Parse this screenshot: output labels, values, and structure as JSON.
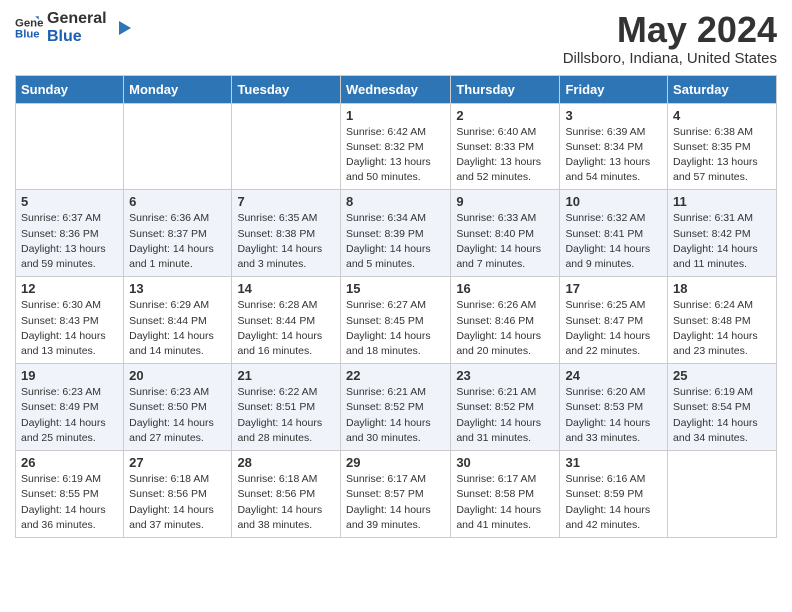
{
  "header": {
    "logo_general": "General",
    "logo_blue": "Blue",
    "month_title": "May 2024",
    "location": "Dillsboro, Indiana, United States"
  },
  "columns": [
    "Sunday",
    "Monday",
    "Tuesday",
    "Wednesday",
    "Thursday",
    "Friday",
    "Saturday"
  ],
  "weeks": [
    [
      {
        "day": "",
        "sunrise": "",
        "sunset": "",
        "daylight": ""
      },
      {
        "day": "",
        "sunrise": "",
        "sunset": "",
        "daylight": ""
      },
      {
        "day": "",
        "sunrise": "",
        "sunset": "",
        "daylight": ""
      },
      {
        "day": "1",
        "sunrise": "Sunrise: 6:42 AM",
        "sunset": "Sunset: 8:32 PM",
        "daylight": "Daylight: 13 hours and 50 minutes."
      },
      {
        "day": "2",
        "sunrise": "Sunrise: 6:40 AM",
        "sunset": "Sunset: 8:33 PM",
        "daylight": "Daylight: 13 hours and 52 minutes."
      },
      {
        "day": "3",
        "sunrise": "Sunrise: 6:39 AM",
        "sunset": "Sunset: 8:34 PM",
        "daylight": "Daylight: 13 hours and 54 minutes."
      },
      {
        "day": "4",
        "sunrise": "Sunrise: 6:38 AM",
        "sunset": "Sunset: 8:35 PM",
        "daylight": "Daylight: 13 hours and 57 minutes."
      }
    ],
    [
      {
        "day": "5",
        "sunrise": "Sunrise: 6:37 AM",
        "sunset": "Sunset: 8:36 PM",
        "daylight": "Daylight: 13 hours and 59 minutes."
      },
      {
        "day": "6",
        "sunrise": "Sunrise: 6:36 AM",
        "sunset": "Sunset: 8:37 PM",
        "daylight": "Daylight: 14 hours and 1 minute."
      },
      {
        "day": "7",
        "sunrise": "Sunrise: 6:35 AM",
        "sunset": "Sunset: 8:38 PM",
        "daylight": "Daylight: 14 hours and 3 minutes."
      },
      {
        "day": "8",
        "sunrise": "Sunrise: 6:34 AM",
        "sunset": "Sunset: 8:39 PM",
        "daylight": "Daylight: 14 hours and 5 minutes."
      },
      {
        "day": "9",
        "sunrise": "Sunrise: 6:33 AM",
        "sunset": "Sunset: 8:40 PM",
        "daylight": "Daylight: 14 hours and 7 minutes."
      },
      {
        "day": "10",
        "sunrise": "Sunrise: 6:32 AM",
        "sunset": "Sunset: 8:41 PM",
        "daylight": "Daylight: 14 hours and 9 minutes."
      },
      {
        "day": "11",
        "sunrise": "Sunrise: 6:31 AM",
        "sunset": "Sunset: 8:42 PM",
        "daylight": "Daylight: 14 hours and 11 minutes."
      }
    ],
    [
      {
        "day": "12",
        "sunrise": "Sunrise: 6:30 AM",
        "sunset": "Sunset: 8:43 PM",
        "daylight": "Daylight: 14 hours and 13 minutes."
      },
      {
        "day": "13",
        "sunrise": "Sunrise: 6:29 AM",
        "sunset": "Sunset: 8:44 PM",
        "daylight": "Daylight: 14 hours and 14 minutes."
      },
      {
        "day": "14",
        "sunrise": "Sunrise: 6:28 AM",
        "sunset": "Sunset: 8:44 PM",
        "daylight": "Daylight: 14 hours and 16 minutes."
      },
      {
        "day": "15",
        "sunrise": "Sunrise: 6:27 AM",
        "sunset": "Sunset: 8:45 PM",
        "daylight": "Daylight: 14 hours and 18 minutes."
      },
      {
        "day": "16",
        "sunrise": "Sunrise: 6:26 AM",
        "sunset": "Sunset: 8:46 PM",
        "daylight": "Daylight: 14 hours and 20 minutes."
      },
      {
        "day": "17",
        "sunrise": "Sunrise: 6:25 AM",
        "sunset": "Sunset: 8:47 PM",
        "daylight": "Daylight: 14 hours and 22 minutes."
      },
      {
        "day": "18",
        "sunrise": "Sunrise: 6:24 AM",
        "sunset": "Sunset: 8:48 PM",
        "daylight": "Daylight: 14 hours and 23 minutes."
      }
    ],
    [
      {
        "day": "19",
        "sunrise": "Sunrise: 6:23 AM",
        "sunset": "Sunset: 8:49 PM",
        "daylight": "Daylight: 14 hours and 25 minutes."
      },
      {
        "day": "20",
        "sunrise": "Sunrise: 6:23 AM",
        "sunset": "Sunset: 8:50 PM",
        "daylight": "Daylight: 14 hours and 27 minutes."
      },
      {
        "day": "21",
        "sunrise": "Sunrise: 6:22 AM",
        "sunset": "Sunset: 8:51 PM",
        "daylight": "Daylight: 14 hours and 28 minutes."
      },
      {
        "day": "22",
        "sunrise": "Sunrise: 6:21 AM",
        "sunset": "Sunset: 8:52 PM",
        "daylight": "Daylight: 14 hours and 30 minutes."
      },
      {
        "day": "23",
        "sunrise": "Sunrise: 6:21 AM",
        "sunset": "Sunset: 8:52 PM",
        "daylight": "Daylight: 14 hours and 31 minutes."
      },
      {
        "day": "24",
        "sunrise": "Sunrise: 6:20 AM",
        "sunset": "Sunset: 8:53 PM",
        "daylight": "Daylight: 14 hours and 33 minutes."
      },
      {
        "day": "25",
        "sunrise": "Sunrise: 6:19 AM",
        "sunset": "Sunset: 8:54 PM",
        "daylight": "Daylight: 14 hours and 34 minutes."
      }
    ],
    [
      {
        "day": "26",
        "sunrise": "Sunrise: 6:19 AM",
        "sunset": "Sunset: 8:55 PM",
        "daylight": "Daylight: 14 hours and 36 minutes."
      },
      {
        "day": "27",
        "sunrise": "Sunrise: 6:18 AM",
        "sunset": "Sunset: 8:56 PM",
        "daylight": "Daylight: 14 hours and 37 minutes."
      },
      {
        "day": "28",
        "sunrise": "Sunrise: 6:18 AM",
        "sunset": "Sunset: 8:56 PM",
        "daylight": "Daylight: 14 hours and 38 minutes."
      },
      {
        "day": "29",
        "sunrise": "Sunrise: 6:17 AM",
        "sunset": "Sunset: 8:57 PM",
        "daylight": "Daylight: 14 hours and 39 minutes."
      },
      {
        "day": "30",
        "sunrise": "Sunrise: 6:17 AM",
        "sunset": "Sunset: 8:58 PM",
        "daylight": "Daylight: 14 hours and 41 minutes."
      },
      {
        "day": "31",
        "sunrise": "Sunrise: 6:16 AM",
        "sunset": "Sunset: 8:59 PM",
        "daylight": "Daylight: 14 hours and 42 minutes."
      },
      {
        "day": "",
        "sunrise": "",
        "sunset": "",
        "daylight": ""
      }
    ]
  ]
}
